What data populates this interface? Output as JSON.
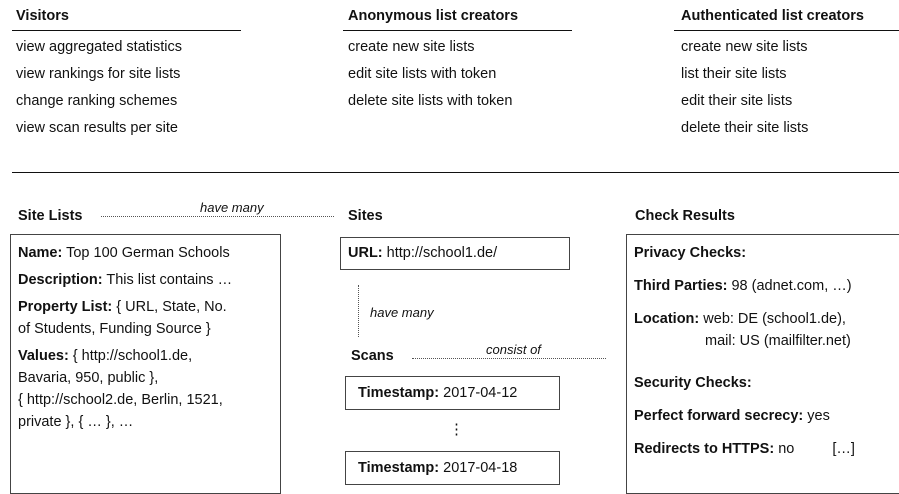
{
  "actors": [
    {
      "title": "Visitors",
      "items": [
        "view aggregated statistics",
        "view rankings for site lists",
        "change ranking schemes",
        "view scan results per site"
      ]
    },
    {
      "title": "Anonymous list creators",
      "items": [
        "create new site lists",
        "edit site lists with token",
        "delete site lists with token"
      ]
    },
    {
      "title": "Authenticated list creators",
      "items": [
        "create new site lists",
        "list their site lists",
        "edit their site lists",
        "delete their site lists"
      ]
    }
  ],
  "site_lists": {
    "title": "Site Lists",
    "relation": "have many",
    "name_label": "Name:",
    "name_value": " Top 100 German Schools",
    "desc_label": "Description:",
    "desc_value": " This list contains …",
    "prop_label": "Property List:",
    "prop_value_1": " { URL, State, No.",
    "prop_value_2": "of Students, Funding Source }",
    "values_label": "Values:",
    "values_1": " { http://school1.de,",
    "values_2": "Bavaria, 950, public },",
    "values_3": "{ http://school2.de, Berlin, 1521,",
    "values_4": "private }, { … }, …"
  },
  "sites": {
    "title": "Sites",
    "url_label": "URL:",
    "url_value": " http://school1.de/",
    "relation": "have many"
  },
  "scans": {
    "title": "Scans",
    "relation": "consist of",
    "ts_label": "Timestamp:",
    "ts1": " 2017-04-12",
    "ts2": " 2017-04-18",
    "ellipsis": "⋮"
  },
  "check_results": {
    "title": "Check Results",
    "privacy": "Privacy Checks:",
    "tp_label": "Third Parties:",
    "tp_value": " 98 (adnet.com, …)",
    "loc_label": "Location:",
    "loc_value_1": " web: DE (school1.de),",
    "loc_value_2": "mail: US (mailfilter.net)",
    "security": "Security Checks:",
    "pfs_label": "Perfect forward secrecy:",
    "pfs_value": " yes",
    "https_label": "Redirects to HTTPS:",
    "https_value": " no",
    "more": "[…]"
  }
}
